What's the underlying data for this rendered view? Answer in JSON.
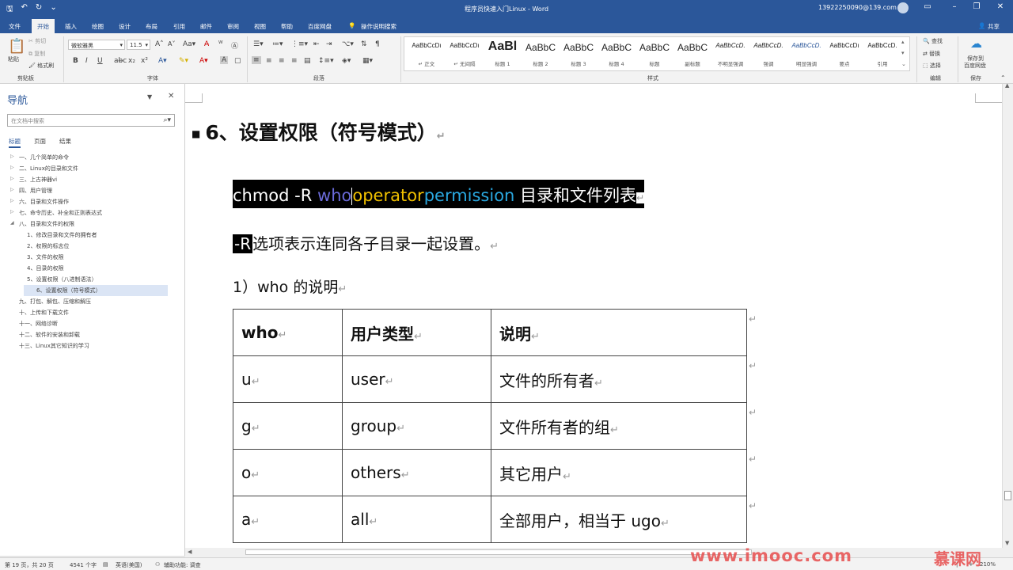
{
  "titlebar": {
    "doc_title": "程序员快速入门Linux  -  Word",
    "account": "13922250090@139.com"
  },
  "ribbon_tabs": [
    "文件",
    "开始",
    "插入",
    "绘图",
    "设计",
    "布局",
    "引用",
    "邮件",
    "审阅",
    "视图",
    "帮助",
    "百度网盘"
  ],
  "tell_me": "操作说明搜索",
  "share": "共享",
  "ribbon": {
    "clipboard": {
      "paste": "粘贴",
      "cut": "剪切",
      "copy": "复制",
      "painter": "格式刷",
      "label": "剪贴板"
    },
    "font": {
      "name": "微软雅黑",
      "size": "11.5",
      "label": "字体"
    },
    "paragraph": {
      "label": "段落"
    },
    "styles": {
      "label": "样式",
      "items": [
        {
          "sample": "AaBbCcDı",
          "name": "↵ 正文",
          "size": 8
        },
        {
          "sample": "AaBbCcDı",
          "name": "↵ 无间隔",
          "size": 8
        },
        {
          "sample": "AaBl",
          "name": "标题 1",
          "size": 16
        },
        {
          "sample": "AaBbC",
          "name": "标题 2",
          "size": 12
        },
        {
          "sample": "AaBbC",
          "name": "标题 3",
          "size": 12
        },
        {
          "sample": "AaBbC",
          "name": "标题 4",
          "size": 12
        },
        {
          "sample": "AaBbC",
          "name": "标题",
          "size": 12
        },
        {
          "sample": "AaBbC",
          "name": "副标题",
          "size": 12
        },
        {
          "sample": "AaBbCcD.",
          "name": "不明显强调",
          "size": 8
        },
        {
          "sample": "AaBbCcD.",
          "name": "强调",
          "size": 8
        },
        {
          "sample": "AaBbCcD.",
          "name": "明显强调",
          "size": 8
        },
        {
          "sample": "AaBbCcDı",
          "name": "要点",
          "size": 8
        },
        {
          "sample": "AaBbCcD.",
          "name": "引用",
          "size": 8
        }
      ]
    },
    "editing": {
      "find": "查找",
      "replace": "替换",
      "select": "选择",
      "label": "编辑"
    },
    "save": {
      "btn1": "保存到",
      "btn2": "百度网盘",
      "label": "保存"
    }
  },
  "nav": {
    "title": "导航",
    "search_placeholder": "在文档中搜索",
    "tabs": [
      "标题",
      "页面",
      "结果"
    ],
    "items": [
      {
        "label": "一、几个简单的命令",
        "level": 1,
        "arrow": "▷"
      },
      {
        "label": "二、Linux的目录和文件",
        "level": 1,
        "arrow": "▷"
      },
      {
        "label": "三、上古神器vi",
        "level": 1,
        "arrow": "▷"
      },
      {
        "label": "四、用户管理",
        "level": 1,
        "arrow": "▷"
      },
      {
        "label": "六、目录和文件操作",
        "level": 1,
        "arrow": "▷"
      },
      {
        "label": "七、命令历史、补全和正则表达式",
        "level": 1,
        "arrow": "▷"
      },
      {
        "label": "八、目录和文件的权限",
        "level": 1,
        "arrow": "◢"
      },
      {
        "label": "1、修改目录和文件的拥有者",
        "level": 2,
        "arrow": ""
      },
      {
        "label": "2、权限的标志位",
        "level": 2,
        "arrow": ""
      },
      {
        "label": "3、文件的权限",
        "level": 2,
        "arrow": ""
      },
      {
        "label": "4、目录的权限",
        "level": 2,
        "arrow": ""
      },
      {
        "label": "5、设置权限（八进制语法）",
        "level": 2,
        "arrow": ""
      },
      {
        "label": "6、设置权限（符号模式）",
        "level": 2,
        "arrow": "",
        "selected": true
      },
      {
        "label": "九、打包、解包、压缩和解压",
        "level": 1,
        "arrow": ""
      },
      {
        "label": "十、上传和下载文件",
        "level": 1,
        "arrow": ""
      },
      {
        "label": "十一、网络诊断",
        "level": 1,
        "arrow": ""
      },
      {
        "label": "十二、软件的安装和卸载",
        "level": 1,
        "arrow": ""
      },
      {
        "label": "十三、Linux其它知识的学习",
        "level": 1,
        "arrow": ""
      }
    ]
  },
  "doc": {
    "heading": "6、设置权限（符号模式）",
    "cmd": {
      "part1": "chmod -R ",
      "who": "who",
      "operator": "operator",
      "permission": "permission",
      "rest": " 目录和文件列表"
    },
    "r_option": "-R",
    "r_text": "选项表示连同各子目录一起设置。",
    "who_heading": "1）who 的说明",
    "table": {
      "headers": [
        "who",
        "用户类型",
        "说明"
      ],
      "rows": [
        [
          "u",
          "user",
          "文件的所有者"
        ],
        [
          "g",
          "group",
          "文件所有者的组"
        ],
        [
          "o",
          "others",
          "其它用户"
        ],
        [
          "a",
          "all",
          "全部用户，相当于 ugo"
        ]
      ]
    },
    "para_mark": "↵"
  },
  "statusbar": {
    "page": "第 19 页，共 20 页",
    "words": "4541 个字",
    "lang": "英语(美国)",
    "access": "辅助功能: 调查",
    "zoom": "210%"
  },
  "watermark": {
    "left": "www.imooc.com",
    "right": "慕课网"
  },
  "colors": {
    "accent": "#2b579a",
    "who": "#6a6ad8",
    "operator": "#f0c000",
    "permission": "#2aa8e0"
  }
}
